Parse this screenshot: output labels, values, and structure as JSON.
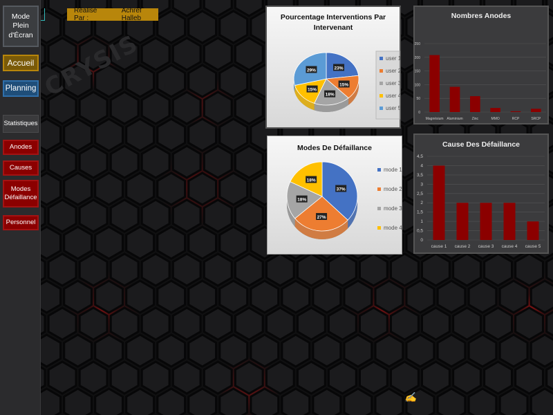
{
  "sidebar": {
    "fullscreen_label": "Mode Plein d'Écran",
    "accueil_label": "Accueil",
    "planning_label": "Planning",
    "statistiques_label": "Statistiques",
    "anodes_label": "Anodes",
    "causes_label": "Causes",
    "modes_label": "Modes Défaillance",
    "personnel_label": "Personnel"
  },
  "author": {
    "label": "Réalisé Par :",
    "name": "Achref Halleb"
  },
  "background": {
    "watermark": "CRYSIS"
  },
  "colors": {
    "blue": "#4472c4",
    "orange": "#ed7d31",
    "gray": "#a5a5a5",
    "yellow": "#ffc000",
    "lightblue": "#5b9bd5",
    "darkred": "#8b0000"
  },
  "chart_data": [
    {
      "id": "interventions",
      "type": "pie",
      "title": "Pourcentage Interventions Par Intervenant",
      "categories": [
        "user 1",
        "user 2",
        "user 3",
        "user 4",
        "user 5"
      ],
      "values": [
        23,
        15,
        18,
        15,
        29
      ],
      "labels": [
        "23%",
        "15%",
        "18%",
        "15%",
        "29%"
      ],
      "colors": [
        "#4472c4",
        "#ed7d31",
        "#a5a5a5",
        "#ffc000",
        "#5b9bd5"
      ],
      "legend": "right"
    },
    {
      "id": "anodes",
      "type": "bar",
      "title": "Nombres Anodes",
      "categories": [
        "Magnésium",
        "Aluminium",
        "Zinc",
        "MMO",
        "RCP",
        "SRCP"
      ],
      "values": [
        208,
        92,
        58,
        15,
        3,
        12
      ],
      "ylim": [
        0,
        250
      ],
      "yticks": [
        "0",
        "50",
        "100",
        "150",
        "200",
        "250"
      ],
      "grid": true
    },
    {
      "id": "modes",
      "type": "pie",
      "title": "Modes De Défaillance",
      "categories": [
        "mode 1",
        "mode 2",
        "mode 3",
        "mode 4"
      ],
      "values": [
        37,
        27,
        18,
        18
      ],
      "labels": [
        "37%",
        "27%",
        "18%",
        "18%"
      ],
      "colors": [
        "#4472c4",
        "#ed7d31",
        "#a5a5a5",
        "#ffc000"
      ],
      "legend": "right"
    },
    {
      "id": "causes",
      "type": "bar",
      "title": "Cause Des Défaillance",
      "categories": [
        "cause 1",
        "cause 2",
        "cause 3",
        "cause 4",
        "cause 5"
      ],
      "values": [
        4,
        2,
        2,
        2,
        1
      ],
      "ylim": [
        0,
        4.5
      ],
      "yticks": [
        "0",
        "0,5",
        "1",
        "1,5",
        "2",
        "2,5",
        "3",
        "3,5",
        "4",
        "4,5"
      ],
      "grid": true
    }
  ]
}
